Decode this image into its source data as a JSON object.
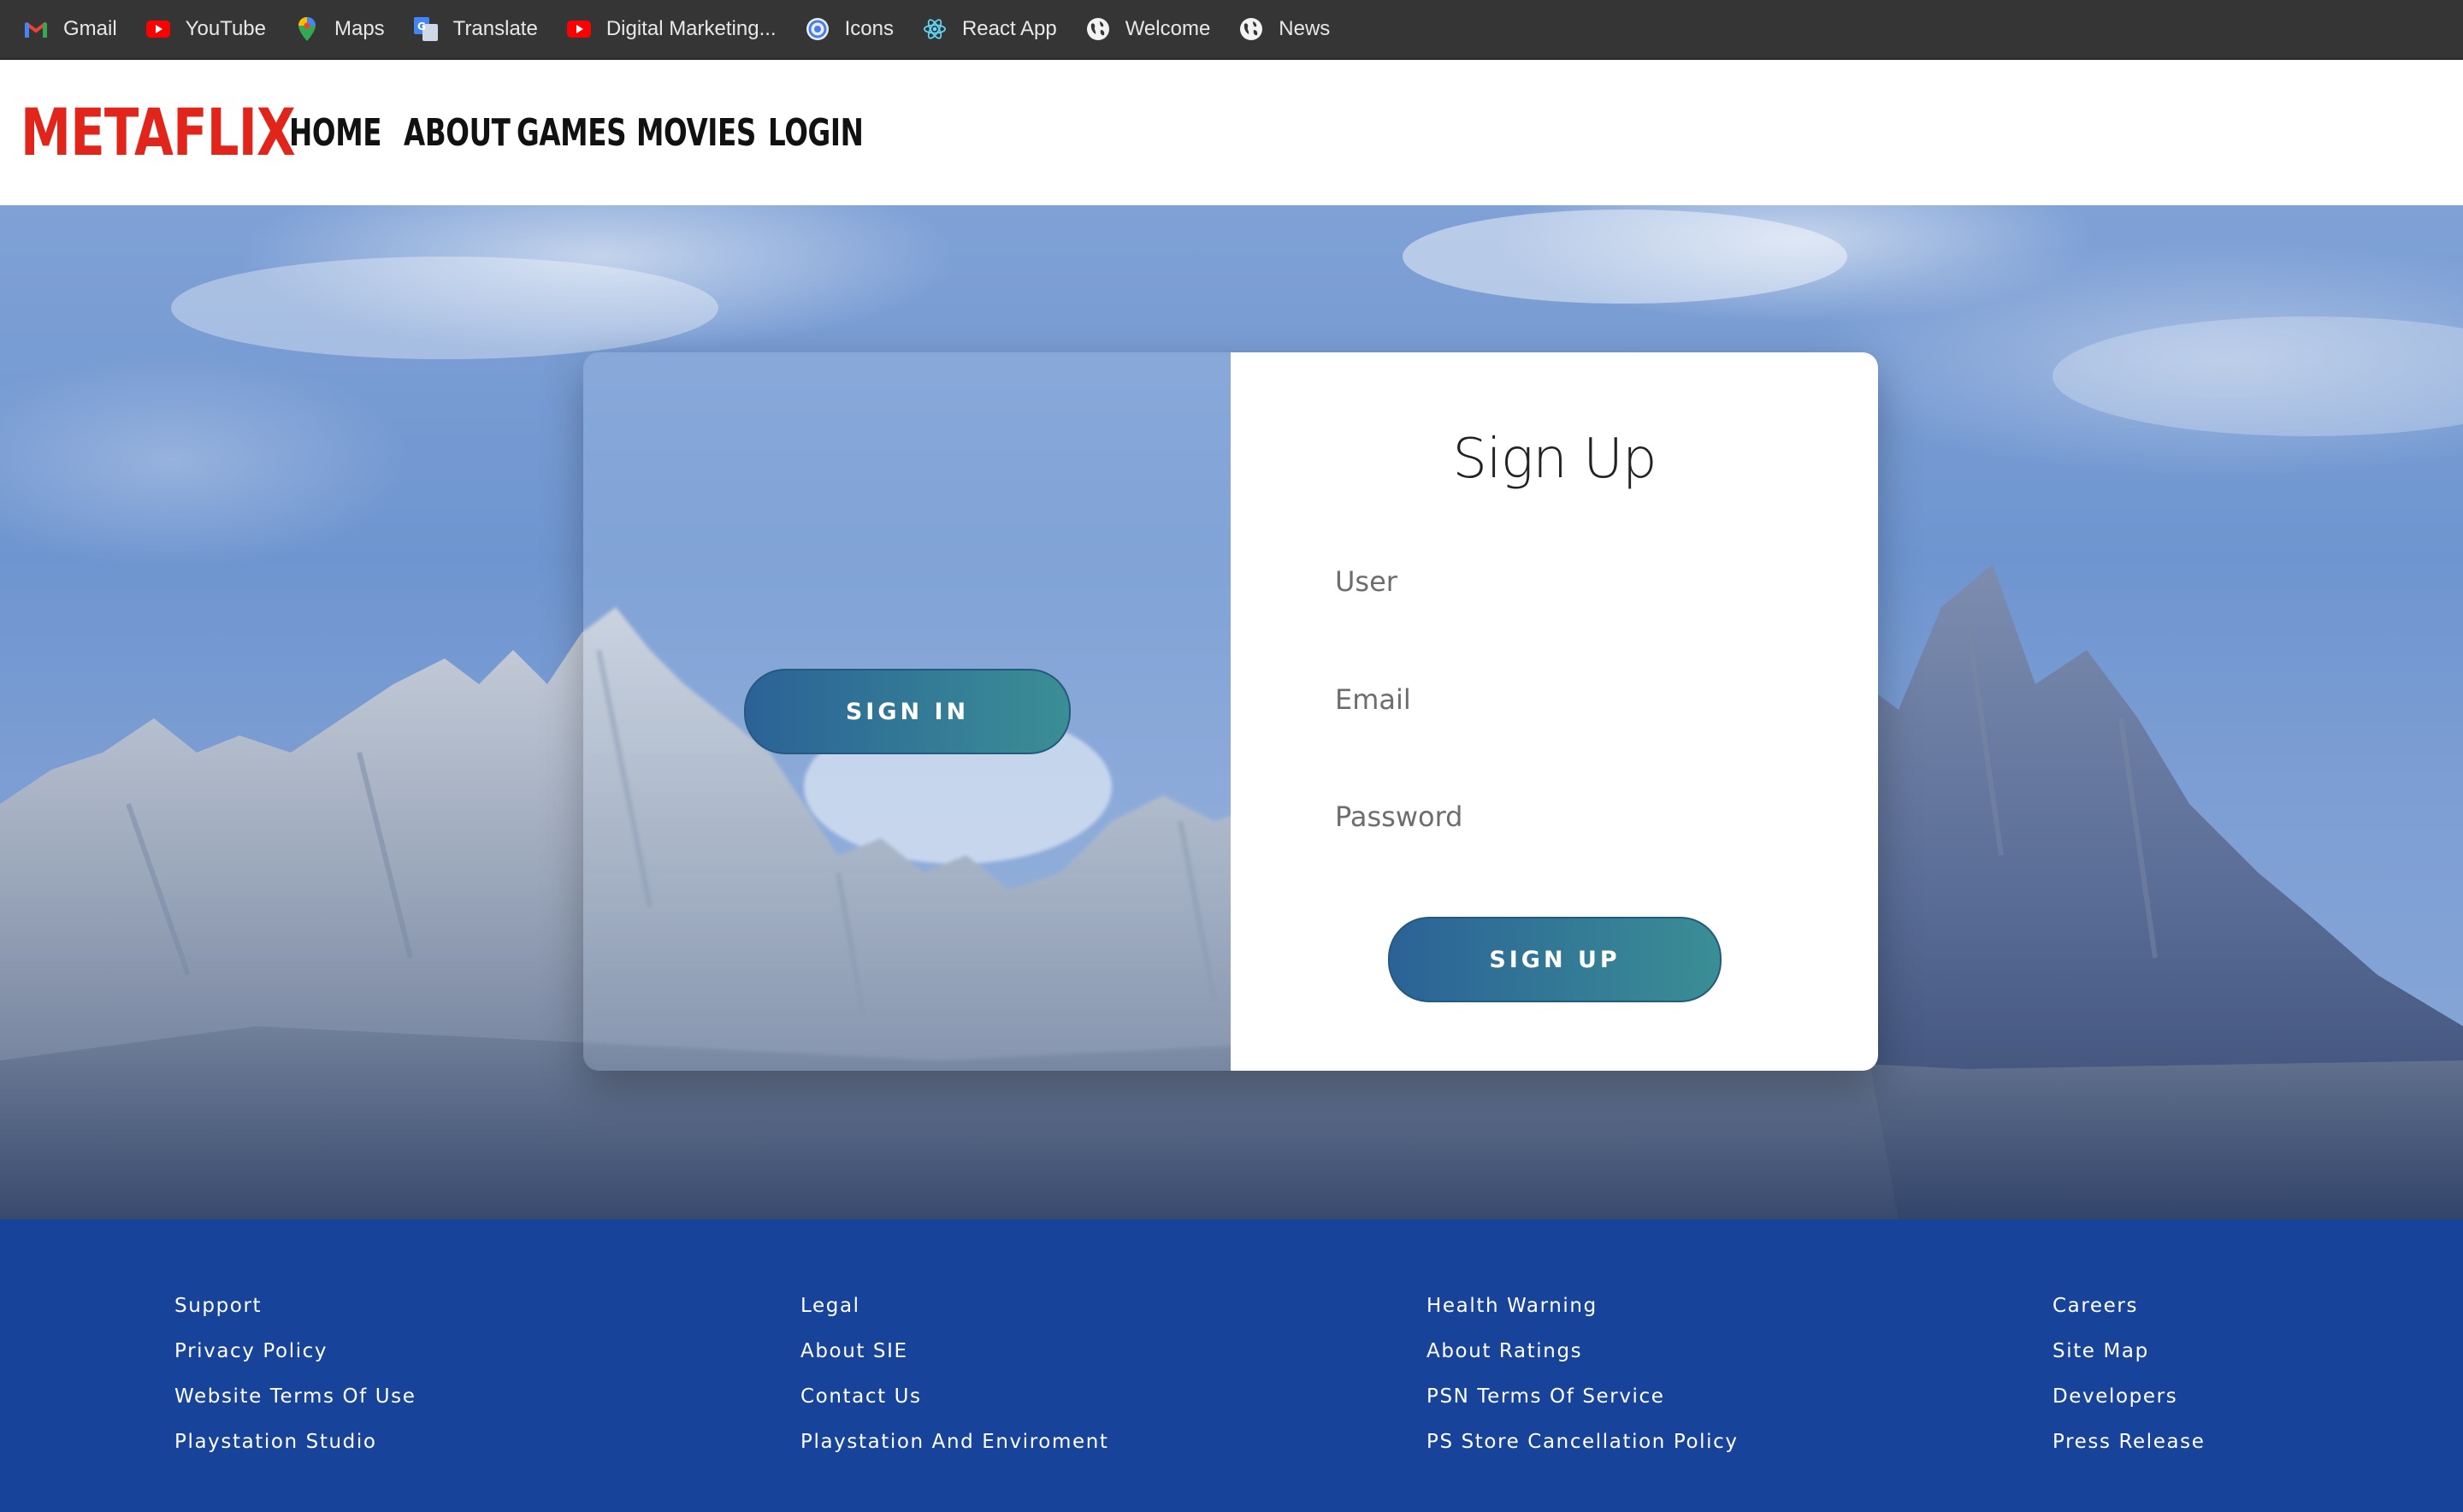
{
  "bookmarks": [
    {
      "label": "Gmail",
      "icon": "gmail-icon"
    },
    {
      "label": "YouTube",
      "icon": "youtube-icon"
    },
    {
      "label": "Maps",
      "icon": "maps-icon"
    },
    {
      "label": "Translate",
      "icon": "translate-icon"
    },
    {
      "label": "Digital Marketing...",
      "icon": "youtube-icon"
    },
    {
      "label": "Icons",
      "icon": "icons-icon"
    },
    {
      "label": "React App",
      "icon": "react-icon"
    },
    {
      "label": "Welcome",
      "icon": "globe-icon"
    },
    {
      "label": "News",
      "icon": "globe-icon"
    }
  ],
  "header": {
    "logo": "METAFLIX",
    "nav": [
      "HOME",
      "ABOUT",
      "GAMES",
      "MOVIES",
      "LOGIN"
    ]
  },
  "auth": {
    "signin_button": "SIGN IN",
    "title": "Sign Up",
    "user_placeholder": "User",
    "email_placeholder": "Email",
    "password_placeholder": "Password",
    "signup_button": "SIGN UP"
  },
  "footer": {
    "columns": [
      [
        "Support",
        "Privacy Policy",
        "Website Terms Of Use",
        "Playstation Studio"
      ],
      [
        "Legal",
        "About SIE",
        "Contact Us",
        "Playstation And Enviroment"
      ],
      [
        "Health Warning",
        "About Ratings",
        "PSN Terms Of Service",
        "PS Store Cancellation Policy"
      ],
      [
        "Careers",
        "Site Map",
        "Developers",
        "Press Release"
      ]
    ]
  },
  "colors": {
    "brand_red": "#e1251b",
    "footer_blue": "#17449a",
    "button_gradient_start": "#2b6297",
    "button_gradient_end": "#3a8e95"
  }
}
